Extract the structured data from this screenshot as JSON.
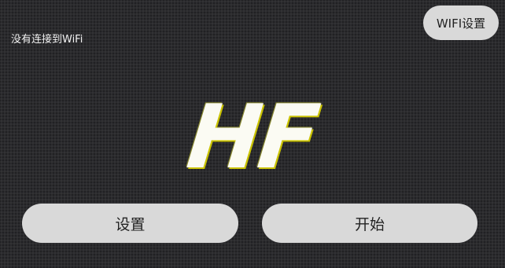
{
  "status": {
    "wifi_status_text": "没有连接到WiFi"
  },
  "header": {
    "wifi_settings_label": "WIFI设置"
  },
  "logo": {
    "text": "HF"
  },
  "actions": {
    "settings_label": "设置",
    "start_label": "开始"
  },
  "colors": {
    "background": "#2b2b2e",
    "button_bg": "#d9d9d9",
    "button_text": "#222222",
    "logo_fill": "#fbfbf3",
    "logo_outline": "#c9c200"
  }
}
